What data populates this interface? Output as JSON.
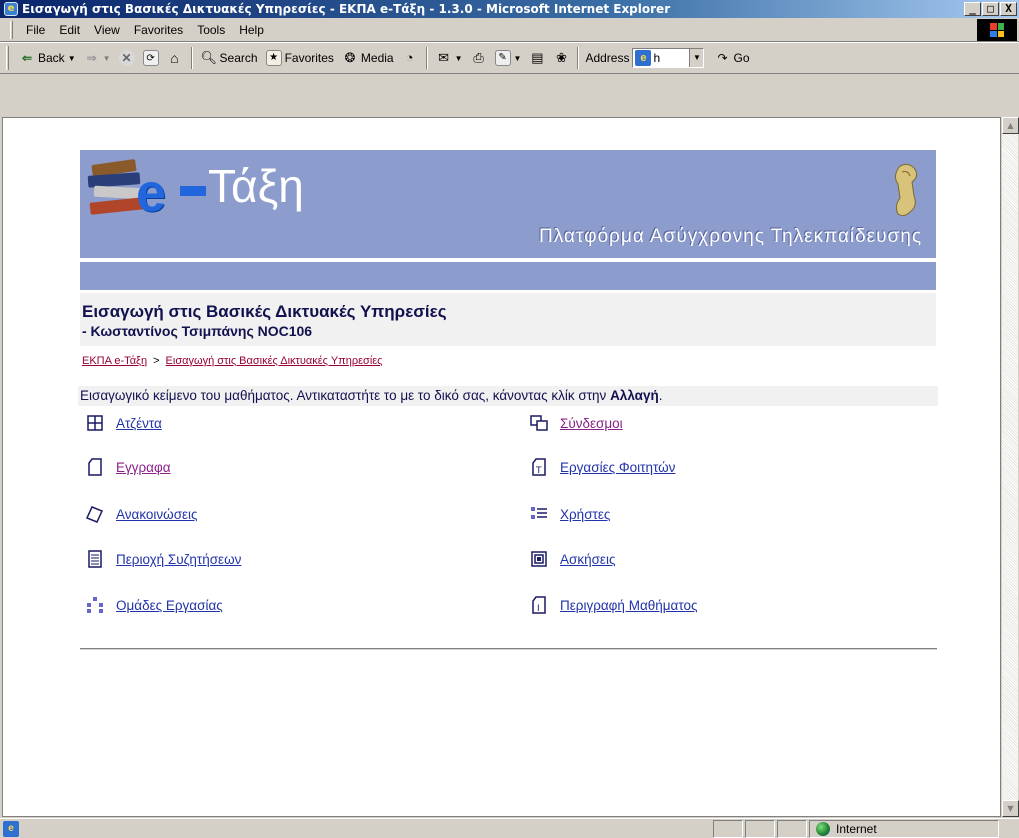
{
  "window": {
    "title": "Εισαγωγή στις Βασικές Δικτυακές Υπηρεσίες - ΕΚΠΑ e-Τάξη - 1.3.0 - Microsoft Internet Explorer",
    "min": "_",
    "max": "□",
    "close": "X"
  },
  "menu": [
    "File",
    "Edit",
    "View",
    "Favorites",
    "Tools",
    "Help"
  ],
  "toolbar": {
    "back": "Back",
    "search": "Search",
    "favorites": "Favorites",
    "media": "Media",
    "address_label": "Address",
    "address_value": "h",
    "go": "Go"
  },
  "status": {
    "zone": "Internet"
  },
  "banner": {
    "logo_e": "e",
    "logo_text": "Τάξη",
    "subtitle": "Πλατφόρμα Ασύγχρονης Τηλεκπαίδευσης"
  },
  "course": {
    "title": "Εισαγωγή στις Βασικές Δικτυακές Υπηρεσίες",
    "teacher": "- Κωσταντίνος Τσιμπάνης NOC106"
  },
  "breadcrumb": {
    "home": "ΕΚΠΑ e-Τάξη",
    "separator": ">",
    "current": "Εισαγωγή στις Βασικές Δικτυακές Υπηρεσίες"
  },
  "intro": {
    "text": "Εισαγωγικό κείμενο του μαθήματος. Αντικαταστήτε το με το δικό σας, κάνοντας κλίκ στην ",
    "link": "Αλλαγή",
    "end": "."
  },
  "tools": {
    "agenda": "Ατζέντα",
    "documents": "Εγγραφα",
    "announcements": "Ανακοινώσεις",
    "forum": "Περιοχή Συζητήσεων",
    "groups": "Ομάδες Εργασίας",
    "links": "Σύνδεσμοι",
    "student_works": "Εργασίες Φοιτητών",
    "users": "Χρήστες",
    "exercises": "Ασκήσεις",
    "description": "Περιγραφή Μαθήματος"
  },
  "colors": {
    "banner": "#8b9ccd",
    "link_blue": "#2233aa",
    "link_visited": "#882288",
    "heading": "#11114f"
  }
}
